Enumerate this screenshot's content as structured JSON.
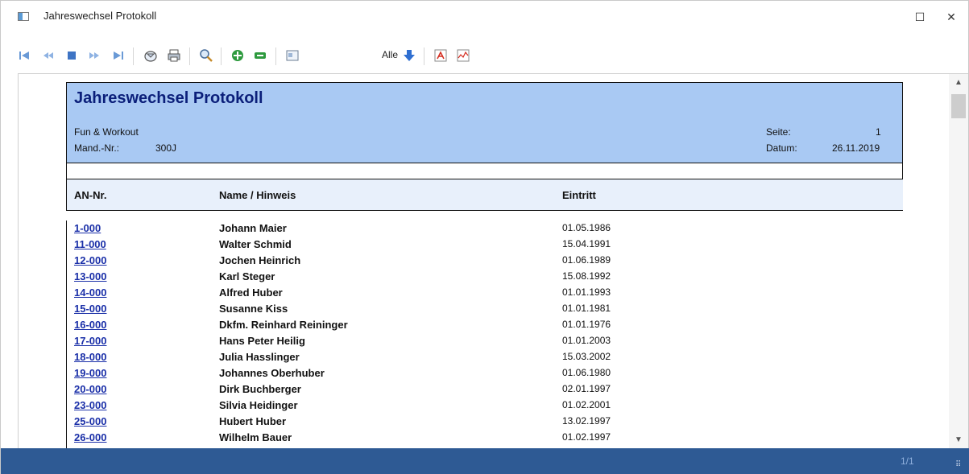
{
  "window": {
    "title": "Jahreswechsel Protokoll",
    "maximize_glyph": "☐",
    "close_glyph": "✕"
  },
  "toolbar": {
    "alle_label": "Alle",
    "icons": [
      "first-page-icon",
      "prev-page-icon",
      "stop-icon",
      "next-page-icon",
      "last-page-icon",
      "send-icon",
      "print-icon",
      "zoom-icon",
      "zoom-in-icon",
      "zoom-out-icon",
      "image-icon",
      "export-down-icon",
      "pdf-icon",
      "chart-icon"
    ]
  },
  "report": {
    "title": "Jahreswechsel Protokoll",
    "company": "Fun & Workout",
    "mand_label": "Mand.-Nr.:",
    "mand_value": "300J",
    "seite_label": "Seite:",
    "seite_value": "1",
    "datum_label": "Datum:",
    "datum_value": "26.11.2019",
    "columns": {
      "nr": "AN-Nr.",
      "name": "Name / Hinweis",
      "eintritt": "Eintritt"
    },
    "rows": [
      {
        "nr": "1-000",
        "name": "Johann Maier",
        "date": "01.05.1986"
      },
      {
        "nr": "11-000",
        "name": "Walter Schmid",
        "date": "15.04.1991"
      },
      {
        "nr": "12-000",
        "name": "Jochen Heinrich",
        "date": "01.06.1989"
      },
      {
        "nr": "13-000",
        "name": "Karl Steger",
        "date": "15.08.1992"
      },
      {
        "nr": "14-000",
        "name": "Alfred Huber",
        "date": "01.01.1993"
      },
      {
        "nr": "15-000",
        "name": "Susanne Kiss",
        "date": "01.01.1981"
      },
      {
        "nr": "16-000",
        "name": "Dkfm. Reinhard Reininger",
        "date": "01.01.1976"
      },
      {
        "nr": "17-000",
        "name": "Hans Peter Heilig",
        "date": "01.01.2003"
      },
      {
        "nr": "18-000",
        "name": "Julia Hasslinger",
        "date": "15.03.2002"
      },
      {
        "nr": "19-000",
        "name": "Johannes Oberhuber",
        "date": "01.06.1980"
      },
      {
        "nr": "20-000",
        "name": "Dirk Buchberger",
        "date": "02.01.1997"
      },
      {
        "nr": "23-000",
        "name": "Silvia Heidinger",
        "date": "01.02.2001"
      },
      {
        "nr": "25-000",
        "name": "Hubert Huber",
        "date": "13.02.1997"
      },
      {
        "nr": "26-000",
        "name": "Wilhelm Bauer",
        "date": "01.02.1997"
      }
    ]
  },
  "status": {
    "page_indicator": "1/1",
    "grip_glyph": "⠿"
  },
  "colors": {
    "header_bg": "#a9c9f3",
    "title_color": "#0b1f7a",
    "link_color": "#1a2fa8",
    "statusbar": "#2e5a94"
  }
}
